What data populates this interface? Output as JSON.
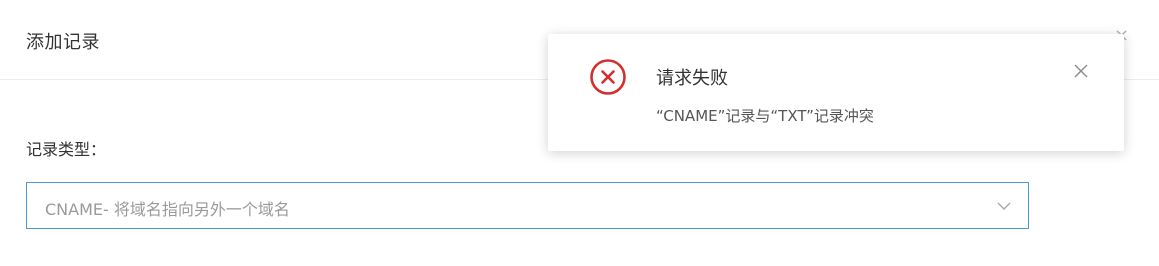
{
  "dialog": {
    "title": "添加记录",
    "close_glyph": "×"
  },
  "form": {
    "record_type_label": "记录类型：",
    "record_type_value": "CNAME- 将域名指向另外一个域名"
  },
  "toast": {
    "title": "请求失败",
    "message": "“CNAME”记录与“TXT”记录冲突",
    "status": "error",
    "accent_color": "#d32f2f",
    "icon": "error-circle-icon"
  },
  "colors": {
    "select_border": "#4a9bd1"
  }
}
